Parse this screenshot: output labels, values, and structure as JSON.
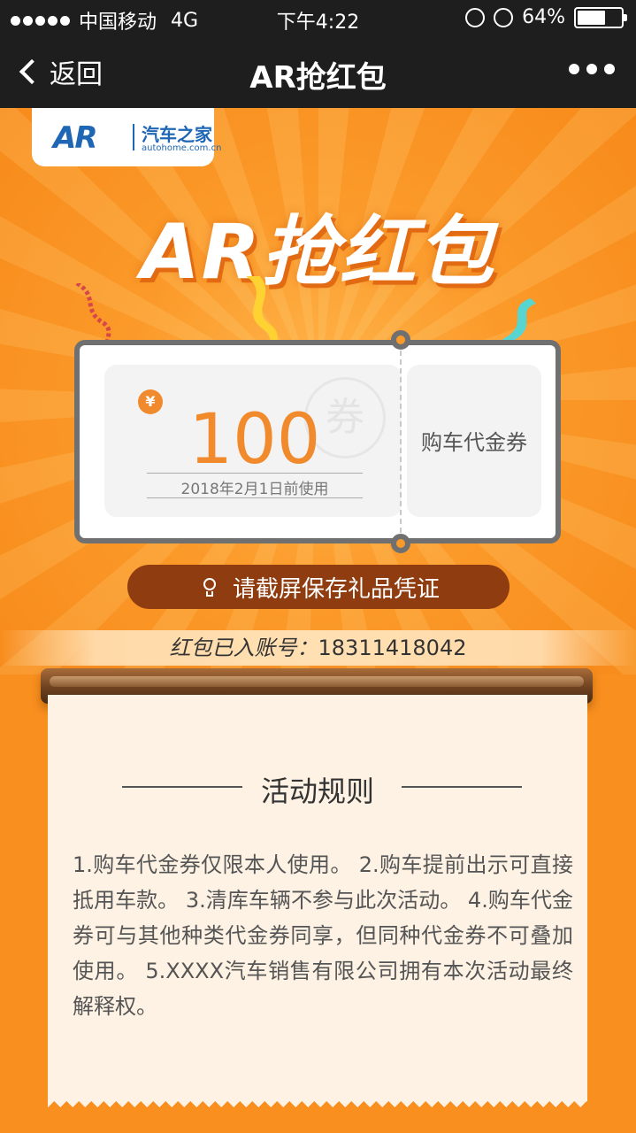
{
  "status_bar": {
    "carrier": "中国移动",
    "network": "4G",
    "time": "下午4:22",
    "battery": "64%",
    "battery_level": 0.64
  },
  "nav": {
    "back_label": "返回",
    "title": "AR抢红包"
  },
  "logo": {
    "mark": "AR",
    "name": "汽车之家",
    "url": "autohome.com.cn"
  },
  "hero_title": "AR抢红包",
  "coupon": {
    "currency_symbol": "¥",
    "amount": "100",
    "expiry": "2018年2月1日前使用",
    "stamp": "券",
    "type": "购车代金券"
  },
  "save_hint": "请截屏保存礼品凭证",
  "account": {
    "label": "红包已入账号：",
    "number": "18311418042"
  },
  "rules": {
    "title": "活动规则",
    "text": "1.购车代金券仅限本人使用。 2.购车提前出示可直接抵用车款。 3.清库车辆不参与此次活动。 4.购车代金券可与其他种类代金券同享，但同种代金券不可叠加使用。 5.XXXX汽车销售有限公司拥有本次活动最终解释权。"
  },
  "colors": {
    "accent": "#f08a2c",
    "background": "#f98f1e",
    "nav": "#1e1e1e"
  }
}
